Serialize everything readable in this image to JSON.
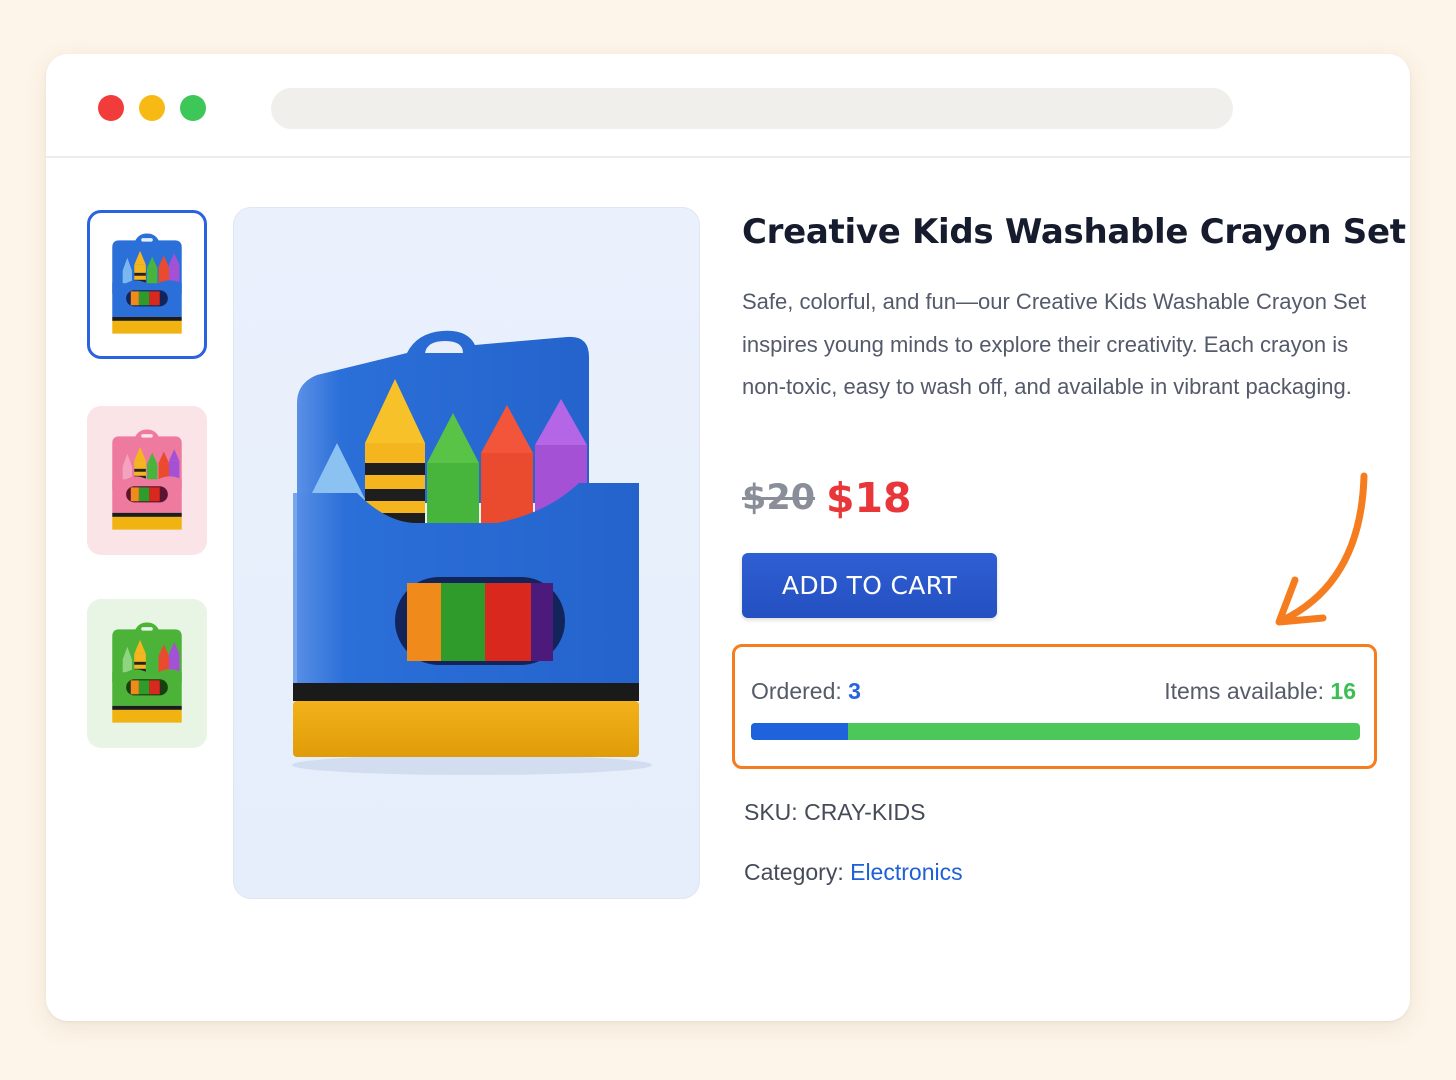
{
  "colors": {
    "page_background": "#fdf5e9",
    "accent_blue": "#2a62e0",
    "sale_red": "#e8363a",
    "available_green": "#3bbf52",
    "highlight_orange": "#f57d1f"
  },
  "browser": {
    "controls": [
      "close-dot",
      "minimize-dot",
      "maximize-dot"
    ],
    "url_value": ""
  },
  "gallery": {
    "thumbnails": [
      {
        "variant": "blue",
        "selected": true
      },
      {
        "variant": "pink",
        "selected": false
      },
      {
        "variant": "green",
        "selected": false
      }
    ],
    "main_image_variant": "blue"
  },
  "product": {
    "title": "Creative Kids Washable Crayon Set",
    "description": "Safe, colorful, and fun—our Creative Kids Washable Crayon Set inspires young minds to explore their creativity. Each crayon is non-toxic, easy to wash off, and available in vibrant packaging.",
    "price_old": "$20",
    "price_new": "$18",
    "add_to_cart_label": "ADD TO CART",
    "sku_label": "SKU:",
    "sku_value": "CRAY-KIDS",
    "category_label": "Category:",
    "category_value": "Electronics"
  },
  "stock": {
    "ordered_label": "Ordered:",
    "ordered_value": "3",
    "available_label": "Items available:",
    "available_value": "16",
    "ordered_fraction": 0.16
  }
}
